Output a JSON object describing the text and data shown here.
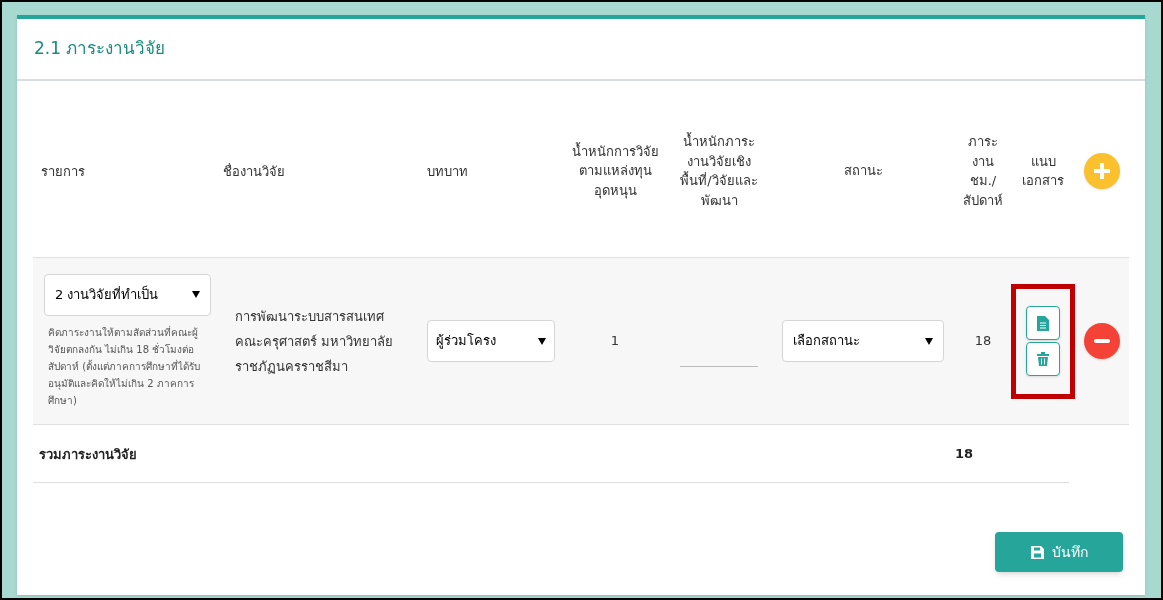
{
  "section_title": "2.1 ภาระงานวิจัย",
  "columns": [
    "รายการ",
    "ชื่องานวิจัย",
    "บทบาท",
    "น้ำหนักการวิจัยตามแหล่งทุนอุดหนุน",
    "น้ำหนักภาระงานวิจัยเชิงพื้นที่/วิจัยและพัฒนา",
    "สถานะ",
    "ภาระงาน ชม./สัปดาห์",
    "แนบเอกสาร"
  ],
  "rows": [
    {
      "category": "2 งานวิจัยที่ทำเป็น",
      "note": "คิดภาระงานให้ตามสัดส่วนที่คณะผู้วิจัยตกลงกัน ไม่เกิน 18 ชั่วโมงต่อสัปดาห์ (ตั้งแต่ภาคการศึกษาที่ได้รับอนุมัติและคิดให้ไม่เกิน 2 ภาคการศึกษา)",
      "title": "การพัฒนาระบบสารสนเทศ คณะครุศาสตร์ มหาวิทยาลัยราชภัฏนครราชสีมา",
      "role": "ผู้ร่วมโครง",
      "weight": "1",
      "status": "เลือกสถานะ",
      "hours": "18",
      "highlighted": true
    }
  ],
  "total": {
    "label": "รวมภาระงานวิจัย",
    "hours": "18"
  },
  "save_button": "บันทึก"
}
